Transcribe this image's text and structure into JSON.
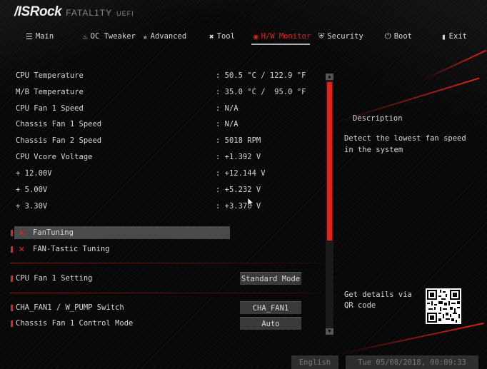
{
  "header": {
    "brand": "/ISRock",
    "product": "FATAL1TY",
    "uefi": "UEFI"
  },
  "nav": {
    "tabs": [
      {
        "label": "Main",
        "icon": "list-icon"
      },
      {
        "label": "OC Tweaker",
        "icon": "flame-icon"
      },
      {
        "label": "Advanced",
        "icon": "star-icon"
      },
      {
        "label": "Tool",
        "icon": "tools-icon"
      },
      {
        "label": "H/W Monitor",
        "icon": "monitor-icon",
        "active": true
      },
      {
        "label": "Security",
        "icon": "shield-icon"
      },
      {
        "label": "Boot",
        "icon": "power-icon"
      },
      {
        "label": "Exit",
        "icon": "exit-icon"
      }
    ]
  },
  "readings": [
    {
      "label": "CPU Temperature",
      "value": ": 50.5 °C / 122.9 °F"
    },
    {
      "label": "M/B Temperature",
      "value": ": 35.0 °C /  95.0 °F"
    },
    {
      "label": "CPU Fan 1 Speed",
      "value": ": N/A"
    },
    {
      "label": "Chassis Fan 1 Speed",
      "value": ": N/A"
    },
    {
      "label": "Chassis Fan 2 Speed",
      "value": ": 5018 RPM"
    },
    {
      "label": "CPU Vcore Voltage",
      "value": ": +1.392 V"
    },
    {
      "label": "+ 12.00V",
      "value": ": +12.144 V"
    },
    {
      "label": "+ 5.00V",
      "value": ": +5.232 V"
    },
    {
      "label": "+ 3.30V",
      "value": ": +3.376 V"
    }
  ],
  "menu": [
    {
      "label": "FanTuning",
      "icon": "wrench-screwdriver-icon"
    },
    {
      "label": "FAN-Tastic Tuning",
      "icon": "wrench-screwdriver-icon"
    }
  ],
  "settings": [
    {
      "label": "CPU Fan 1 Setting",
      "value": "Standard Mode"
    },
    {
      "label": "CHA_FAN1 / W_PUMP Switch",
      "value": "CHA_FAN1"
    },
    {
      "label": "Chassis Fan 1 Control Mode",
      "value": "Auto"
    }
  ],
  "description": {
    "title": "Description",
    "text": "Detect the lowest fan speed in the system"
  },
  "qr": {
    "text": "Get details via QR code"
  },
  "footer": {
    "language": "English",
    "datetime": "Tue 05/08/2018, 00:09:33"
  },
  "colors": {
    "accent": "#e2231a",
    "background": "#050505",
    "text": "#d8d8d8",
    "selection": "#4a4a4a"
  }
}
